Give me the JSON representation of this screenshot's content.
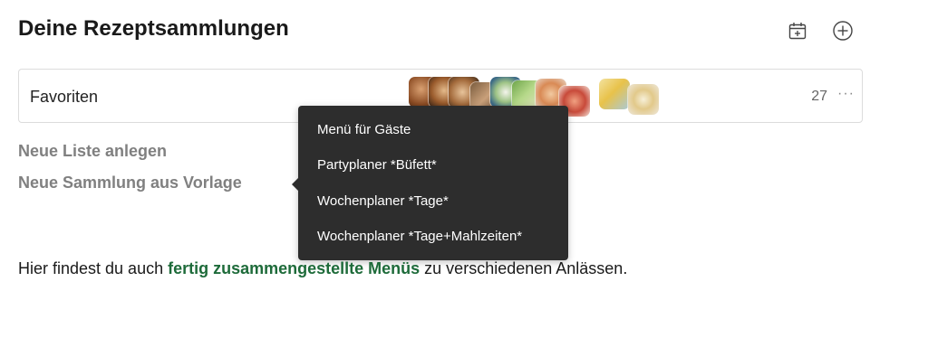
{
  "header": {
    "title": "Deine Rezeptsammlungen",
    "icons": [
      "calendar-add-icon",
      "plus-circle-icon"
    ]
  },
  "collections": [
    {
      "name": "Favoriten",
      "count": "27",
      "more": "···",
      "thumbnails": [
        "food-photo-1",
        "food-photo-2",
        "food-photo-3",
        "food-photo-4",
        "food-photo-5",
        "food-photo-6",
        "food-photo-7",
        "food-photo-8",
        "food-photo-9",
        "food-photo-10"
      ]
    }
  ],
  "actions": {
    "new_list": "Neue Liste anlegen",
    "new_from_template": "Neue Sammlung aus Vorlage"
  },
  "template_menu": {
    "items": [
      "Menü für Gäste",
      "Partyplaner *Büfett*",
      "Wochenplaner *Tage*",
      "Wochenplaner *Tage+Mahlzeiten*"
    ]
  },
  "footer": {
    "text_before": "Hier findest du auch ",
    "link": "fertig zusammengestellte Menüs",
    "text_after": " zu verschiedenen Anlässen."
  },
  "colors": {
    "accent_green": "#1e6b3a",
    "popup_bg": "#2d2d2d",
    "muted_text": "#808080"
  }
}
